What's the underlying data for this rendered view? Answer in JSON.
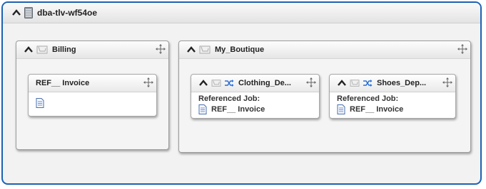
{
  "host": {
    "title": "dba-tlv-wf54oe"
  },
  "billing": {
    "title": "Billing",
    "card": {
      "title": "REF__ Invoice"
    }
  },
  "boutique": {
    "title": "My_Boutique",
    "cards": [
      {
        "title": "Clothing_De...",
        "ref_label": "Referenced Job:",
        "ref_item": "REF__ Invoice"
      },
      {
        "title": "Shoes_Dep...",
        "ref_label": "Referenced Job:",
        "ref_item": "REF__ Invoice"
      }
    ]
  },
  "colors": {
    "frame_border": "#1b62b3",
    "shuffle_icon": "#2a6fd6"
  }
}
